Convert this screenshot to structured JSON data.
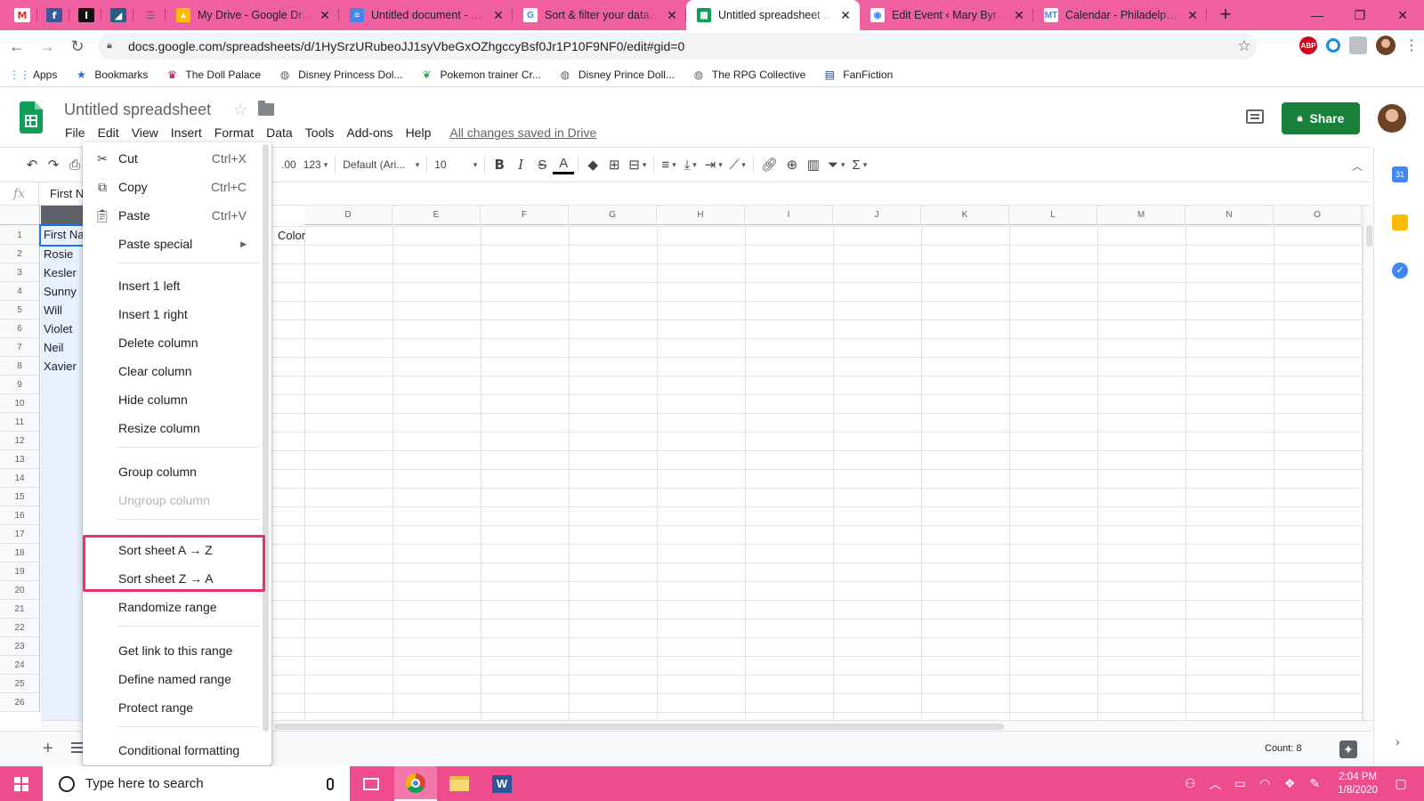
{
  "browser": {
    "pinned": [
      {
        "name": "gmail",
        "letter": "M",
        "color": "#ffffff",
        "fg": "#d93025"
      },
      {
        "name": "facebook",
        "letter": "f",
        "color": "#3b5998",
        "fg": "#ffffff"
      },
      {
        "name": "imdb",
        "letter": "I",
        "color": "#111111",
        "fg": "#ffffff"
      },
      {
        "name": "app",
        "letter": "◢",
        "color": "#2a5d84",
        "fg": "#ffffff"
      },
      {
        "name": "app2",
        "letter": "☰",
        "color": "transparent",
        "fg": "#5f6368"
      }
    ],
    "tabs": [
      {
        "title": "My Drive - Google Drive",
        "icon": "drive-icon",
        "fav_color": "#fbbc04",
        "fav_text": "▲",
        "active": false
      },
      {
        "title": "Untitled document - Google Docs",
        "icon": "docs-icon",
        "fav_color": "#4285f4",
        "fav_text": "≡",
        "active": false
      },
      {
        "title": "Sort & filter your data - Computer",
        "icon": "google-icon",
        "fav_color": "#ffffff",
        "fav_text": "G",
        "active": false
      },
      {
        "title": "Untitled spreadsheet - Google Sheets",
        "icon": "sheets-icon",
        "fav_color": "#0f9d58",
        "fav_text": "▦",
        "active": true
      },
      {
        "title": "Edit Event ‹ Mary Byrnes",
        "icon": "wordpress-icon",
        "fav_color": "#ffffff",
        "fav_text": "◉",
        "active": false
      },
      {
        "title": "Calendar - Philadelphia, PA",
        "icon": "mt-icon",
        "fav_color": "#ffffff",
        "fav_text": "MT",
        "active": false
      }
    ],
    "url": "docs.google.com/spreadsheets/d/1HySrzURubeoJJ1syVbeGxOZhgccyBsf0Jr1P10F9NF0/edit#gid=0",
    "bookmarks": [
      {
        "label": "Apps",
        "icon": "apps-grid-icon"
      },
      {
        "label": "Bookmarks",
        "icon": "star-icon"
      },
      {
        "label": "The Doll Palace",
        "icon": "doll-icon"
      },
      {
        "label": "Disney Princess Dol...",
        "icon": "globe-icon"
      },
      {
        "label": "Pokemon trainer Cr...",
        "icon": "leaf-icon"
      },
      {
        "label": "Disney Prince Doll...",
        "icon": "globe-icon"
      },
      {
        "label": "The RPG Collective",
        "icon": "globe-icon"
      },
      {
        "label": "FanFiction",
        "icon": "book-icon"
      }
    ]
  },
  "sheets": {
    "title": "Untitled spreadsheet",
    "menus": [
      "File",
      "Edit",
      "View",
      "Insert",
      "Format",
      "Data",
      "Tools",
      "Add-ons",
      "Help"
    ],
    "saved_status": "All changes saved in Drive",
    "share_label": "Share",
    "toolbar": {
      "decimal": ".00",
      "number_format": "123",
      "font": "Default (Ari...",
      "size": "10"
    },
    "formula_value": "First Name",
    "columns": [
      "D",
      "E",
      "F",
      "G",
      "H",
      "I",
      "J",
      "K",
      "L",
      "M",
      "N",
      "O"
    ],
    "rows": [
      "1",
      "2",
      "3",
      "4",
      "5",
      "6",
      "7",
      "8",
      "9",
      "10",
      "11",
      "12",
      "13",
      "14",
      "15",
      "16",
      "17",
      "18",
      "19",
      "20",
      "21",
      "22",
      "23",
      "24",
      "25",
      "26"
    ],
    "col_a_values": [
      "First Na",
      "Rosie",
      "Kesler",
      "Sunny",
      "Will",
      "Violet",
      "Neil",
      "Xavier"
    ],
    "c1_value": "Color",
    "count_label": "Count: 8"
  },
  "context_menu": {
    "cut": {
      "label": "Cut",
      "shortcut": "Ctrl+X"
    },
    "copy": {
      "label": "Copy",
      "shortcut": "Ctrl+C"
    },
    "paste": {
      "label": "Paste",
      "shortcut": "Ctrl+V"
    },
    "paste_special": "Paste special",
    "insert_left": "Insert 1 left",
    "insert_right": "Insert 1 right",
    "delete_column": "Delete column",
    "clear_column": "Clear column",
    "hide_column": "Hide column",
    "resize_column": "Resize column",
    "group_column": "Group column",
    "ungroup_column": "Ungroup column",
    "sort_az": "Sort sheet A → Z",
    "sort_za": "Sort sheet Z → A",
    "randomize": "Randomize range",
    "get_link": "Get link to this range",
    "define_named": "Define named range",
    "protect": "Protect range",
    "conditional": "Conditional formatting"
  },
  "taskbar": {
    "search_placeholder": "Type here to search",
    "time": "2:04 PM",
    "date": "1/8/2020"
  },
  "colors": {
    "tab_strip": "#f05fa0",
    "taskbar": "#ee4c8c",
    "highlight": "#e8336f",
    "share": "#188038"
  }
}
